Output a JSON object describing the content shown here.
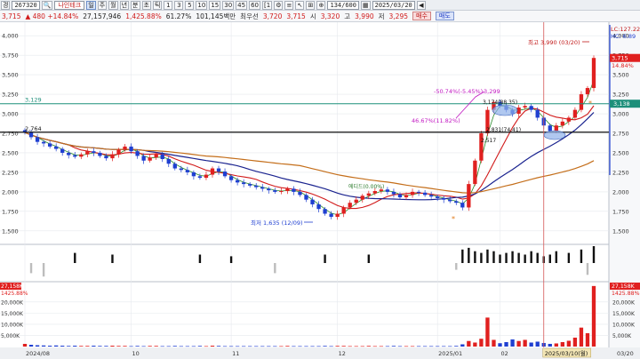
{
  "toolbar": {
    "items": [
      "경",
      "◀"
    ],
    "code": "267320",
    "search_icon": "search-icon",
    "name": "나인테크",
    "periods": [
      "주",
      "월",
      "년",
      "분",
      "초",
      "틱"
    ],
    "intervals": [
      "1",
      "3",
      "5",
      "10",
      "15",
      "30",
      "45",
      "60",
      "[1"
    ],
    "counter": "134/600",
    "date": "2025/03/20"
  },
  "quote": {
    "price": "3,715",
    "change": "480",
    "change_pct": "+14.84%",
    "volume": "27,157,946",
    "volume_ratio": "1,425.88%",
    "turnover_ratio": "61.27%",
    "amount": "101,145백만",
    "prev_label": "최우선",
    "prev_a": "3,720",
    "prev_b": "3,715",
    "open_label": "시",
    "open": "3,320",
    "high_label": "고",
    "high": "3,990",
    "low_label": "저",
    "low": "3,295",
    "buy_label": "매수",
    "sell_label": "매도"
  },
  "chart_data": {
    "type": "candlestick",
    "price_axis": {
      "ticks": [
        "4,000",
        "3,750",
        "3,500",
        "3,250",
        "3,000",
        "2,750",
        "2,500",
        "2,250",
        "2,000",
        "1,750",
        "1,500"
      ],
      "range": [
        1350,
        4150
      ]
    },
    "volume_axis": {
      "ticks": [
        "20,000K",
        "15,000K",
        "10,000K",
        "5,000K"
      ],
      "range": [
        0,
        27500000
      ]
    },
    "x_labels": [
      "2024/08",
      "10",
      "11",
      "12",
      "2025/01",
      "02",
      "2025/03/10(월)",
      "03/20"
    ],
    "right_labels": {
      "top_a": "LC:127.22",
      "top_b": "HC: 6.89",
      "current": "3,715",
      "current_pct": "14.84%",
      "ref_line": "3,138",
      "vol_value": "27,158K",
      "vol_pct": "1425.88%"
    },
    "left_labels": {
      "line_a": "3,129",
      "line_b": "2,764",
      "vol_value": "27,158K",
      "vol_pct": "1425.88%"
    },
    "annotations": {
      "high": "최고 3,990 (03/20)",
      "low": "최저 1,635 (12/09)",
      "fib_a": "-50.74%(-5.45%)",
      "fib_b": "46.67%(11.82%)",
      "peak": "3,299",
      "box_a": "3,174(88.35)",
      "box_b": "2,831(74.41)",
      "box_c": "2,517",
      "sub_value": "2,765",
      "mid_label": "에디드(0.00%)"
    },
    "reference_lines": [
      3129,
      2764
    ],
    "closes": [
      2760,
      2700,
      2640,
      2620,
      2580,
      2550,
      2500,
      2470,
      2450,
      2480,
      2520,
      2500,
      2460,
      2430,
      2480,
      2540,
      2580,
      2520,
      2460,
      2400,
      2440,
      2480,
      2420,
      2360,
      2300,
      2280,
      2250,
      2200,
      2180,
      2220,
      2300,
      2260,
      2200,
      2150,
      2120,
      2100,
      2080,
      2060,
      2040,
      2020,
      2000,
      2010,
      2040,
      2000,
      1960,
      1900,
      1840,
      1780,
      1720,
      1680,
      1720,
      1800,
      1860,
      1900,
      1950,
      1980,
      2010,
      2030,
      2000,
      1970,
      1930,
      1960,
      2000,
      1990,
      1960,
      1940,
      1920,
      1900,
      1880,
      1860,
      1800,
      2100,
      2400,
      2750,
      3050,
      3150,
      3100,
      3050,
      3000,
      3080,
      3100,
      3050,
      2950,
      2850,
      2780,
      2850,
      2900,
      2950,
      3050,
      3250,
      3330,
      3715
    ],
    "volumes": [
      1.2,
      0.8,
      0.6,
      0.5,
      0.4,
      0.5,
      0.4,
      0.3,
      0.4,
      0.3,
      0.3,
      0.4,
      0.3,
      0.3,
      0.4,
      0.3,
      0.3,
      0.2,
      0.3,
      0.2,
      0.3,
      0.3,
      0.2,
      0.2,
      0.3,
      0.2,
      0.2,
      0.2,
      0.3,
      0.2,
      0.4,
      0.3,
      0.2,
      0.2,
      0.2,
      0.2,
      0.2,
      0.2,
      0.2,
      0.2,
      0.2,
      0.2,
      0.3,
      0.2,
      0.2,
      0.2,
      0.2,
      0.2,
      0.3,
      0.2,
      0.3,
      0.3,
      0.2,
      0.2,
      0.2,
      0.3,
      0.2,
      0.2,
      0.2,
      0.3,
      0.2,
      0.2,
      0.2,
      0.2,
      0.2,
      0.2,
      0.2,
      0.2,
      0.2,
      0.3,
      1.0,
      2.5,
      1.8,
      3.5,
      13.0,
      3.0,
      1.5,
      2.0,
      3.2,
      2.5,
      3.0,
      1.8,
      2.2,
      1.6,
      1.2,
      1.4,
      2.0,
      2.6,
      4.0,
      8.5,
      6.0,
      27.16
    ],
    "osc": [
      0,
      -0.6,
      0,
      -0.8,
      0,
      0,
      0,
      0,
      0.6,
      0,
      0,
      0,
      0,
      0,
      0.5,
      0,
      0,
      0,
      0,
      0,
      0,
      0,
      0,
      0,
      0,
      0,
      0,
      0,
      0.5,
      0,
      0,
      0,
      0,
      0.4,
      0,
      0,
      0,
      0,
      0,
      0,
      -0.6,
      0,
      0,
      0,
      0,
      0,
      0,
      0,
      0.5,
      0,
      0,
      0,
      0,
      0,
      0,
      0.5,
      0,
      0,
      0,
      0,
      0,
      0,
      0,
      0,
      0,
      0,
      0,
      0,
      0,
      -0.4,
      0.8,
      0.9,
      0.7,
      0.6,
      0.8,
      0.7,
      0.5,
      0.6,
      0.7,
      0.6,
      0.5,
      0.7,
      0.6,
      0.4,
      0.5,
      0.7,
      0,
      0.6,
      0,
      0.8,
      -0.7,
      1.0
    ]
  },
  "colors": {
    "up": "#e0201f",
    "down": "#1f3fd1",
    "ma_short": "#d11a1a",
    "ma_mid": "#1a238f",
    "ma_long": "#c46e1a",
    "ma_fast": "#2a8a2a",
    "teal_line": "#1d8f7a",
    "grid": "#e6e9ee"
  }
}
